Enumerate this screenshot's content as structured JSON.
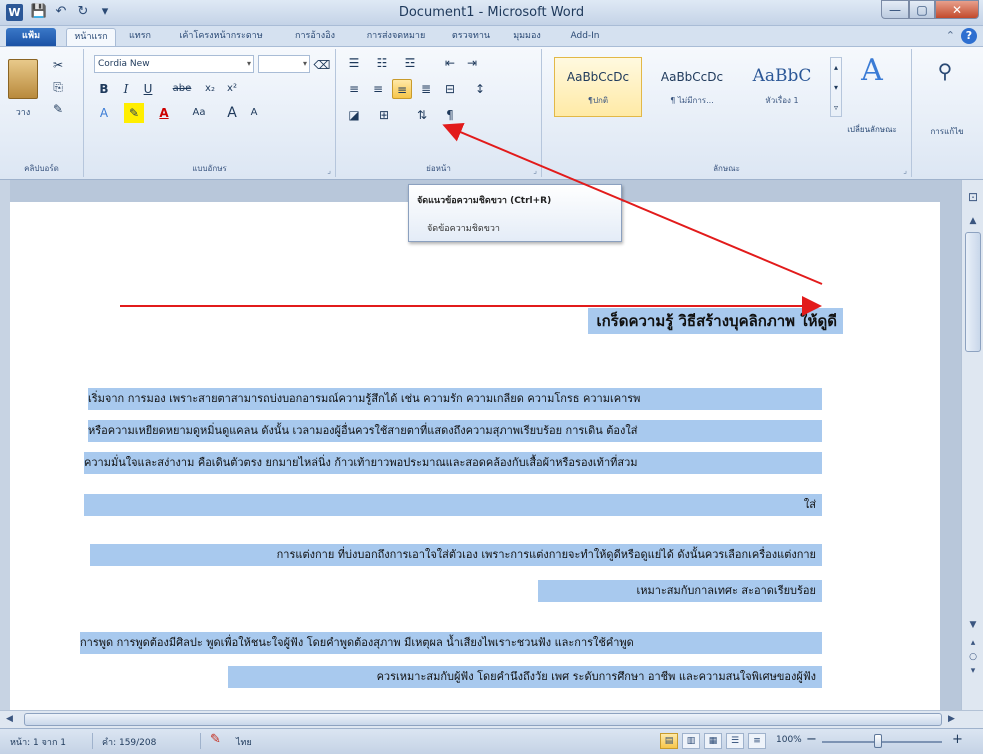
{
  "window": {
    "title": "Document1 - Microsoft Word",
    "app_icon": "W",
    "controls": {
      "minimize": "—",
      "maximize": "▢",
      "close": "✕"
    }
  },
  "quick_access": {
    "save": "💾",
    "undo": "↶",
    "redo": "↻",
    "more": "▾"
  },
  "tabs": {
    "file": "แฟ้ม",
    "items": [
      "หน้าแรก",
      "แทรก",
      "เค้าโครงหน้ากระดาษ",
      "การอ้างอิง",
      "การส่งจดหมาย",
      "ตรวจทาน",
      "มุมมอง",
      "Add-In"
    ]
  },
  "ribbon": {
    "clipboard": {
      "paste": "วาง",
      "label": "คลิปบอร์ด"
    },
    "font": {
      "name": "Cordia New",
      "size": "",
      "label": "แบบอักษร",
      "bold": "B",
      "italic": "I",
      "underline": "U",
      "strike": "abe",
      "subscript": "x₂",
      "superscript": "x²",
      "font_color": "A",
      "change_case": "Aa",
      "grow": "A",
      "shrink": "A"
    },
    "paragraph": {
      "label": "ย่อหน้า",
      "show_marks": "¶"
    },
    "styles": {
      "label": "ลักษณะ",
      "items": [
        {
          "sample": "AaBbCcDc",
          "name": "¶ปกติ"
        },
        {
          "sample": "AaBbCcDc",
          "name": "¶ ไม่มีการ..."
        },
        {
          "sample": "AaBbC",
          "name": "หัวเรื่อง 1"
        }
      ],
      "change_styles": "เปลี่ยนลักษณะ"
    },
    "editing": {
      "label": "การแก้ไข"
    }
  },
  "tooltip": {
    "title": "จัดแนวข้อความชิดขวา (Ctrl+R)",
    "description": "จัดข้อความชิดขวา"
  },
  "document": {
    "heading": "เกร็ดความรู้ วิธีสร้างบุคลิกภาพ ให้ดูดี",
    "lines": [
      "เริ่มจาก การมอง เพราะสายตาสามารถบ่งบอกอารมณ์ความรู้สึกได้ เช่น ความรัก ความเกลียด ความโกรธ ความเคารพ",
      "หรือความเหยียดหยามดูหมิ่นดูแคลน ดังนั้น เวลามองผู้อื่นควรใช้สายตาที่แสดงถึงความสุภาพเรียบร้อย การเดิน ต้องใส่",
      "ความมั่นใจและสง่างาม คือเดินตัวตรง ยกมายไหล่นิ่ง ก้าวเท้ายาวพอประมาณและสอดคล้องกับเสื้อผ้าหรือรองเท้าที่สวม",
      "ใส่",
      "การแต่งกาย ที่บ่งบอกถึงการเอาใจใส่ตัวเอง เพราะการแต่งกายจะทำให้ดูดีหรือดูแย่ได้ ดังนั้นควรเลือกเครื่องแต่งกาย",
      "เหมาะสมกับกาลเทศะ สะอาดเรียบร้อย",
      "การพูด การพูดต้องมีศิลปะ พูดเพื่อให้ชนะใจผู้ฟัง โดยคำพูดต้องสุภาพ มีเหตุผล น้ำเสียงไพเราะชวนฟัง และการใช้คำพูด",
      "ควรเหมาะสมกับผู้ฟัง โดยคำนึงถึงวัย เพศ ระดับการศึกษา อาชีพ และความสนใจพิเศษของผู้ฟัง"
    ]
  },
  "status": {
    "page": "หน้า: 1 จาก 1",
    "words": "คำ: 159/208",
    "language": "ไทย",
    "zoom": "100%",
    "zoom_out": "−",
    "zoom_in": "+"
  },
  "colors": {
    "selection": "#a8c9ee",
    "arrow": "#e21b1b",
    "ribbon": "#dce6f3"
  }
}
